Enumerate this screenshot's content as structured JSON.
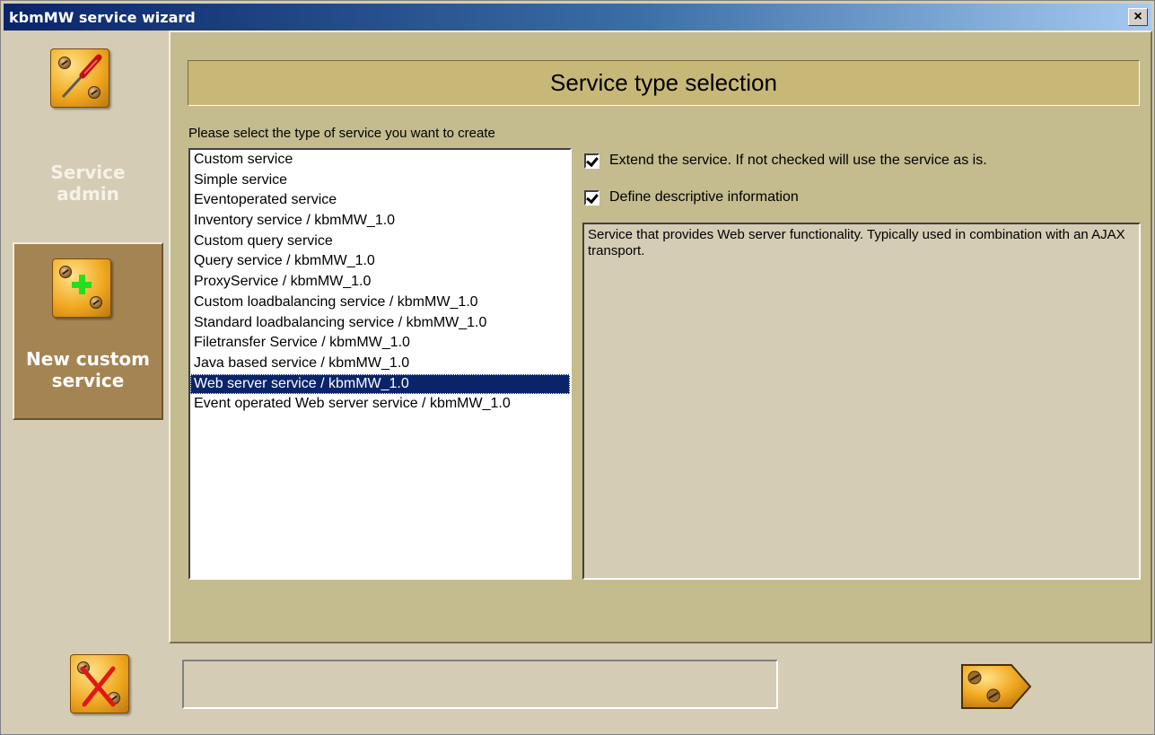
{
  "window": {
    "title": "kbmMW service wizard",
    "close_symbol": "×"
  },
  "sidebar": {
    "items": [
      {
        "label_line1": "Service",
        "label_line2": "admin",
        "icon": "screwdriver-icon"
      },
      {
        "label_line1": "New custom",
        "label_line2": "service",
        "icon": "new-plus-icon",
        "active": true
      }
    ]
  },
  "main": {
    "header_title": "Service type selection",
    "instruction": "Please select the type of service you want to create",
    "service_types": [
      "Custom service",
      "Simple service",
      "Eventoperated service",
      "Inventory service / kbmMW_1.0",
      "Custom query service",
      "Query service / kbmMW_1.0",
      "ProxyService / kbmMW_1.0",
      "Custom loadbalancing service / kbmMW_1.0",
      "Standard loadbalancing service / kbmMW_1.0",
      "Filetransfer Service / kbmMW_1.0",
      "Java based service / kbmMW_1.0",
      "Web server service / kbmMW_1.0",
      "Event operated Web server service / kbmMW_1.0"
    ],
    "selected_index": 11,
    "options": {
      "extend_label": "Extend the service. If not checked will use the service as is.",
      "extend_checked": true,
      "define_label": "Define descriptive information",
      "define_checked": true
    },
    "description": "Service that provides Web server functionality. Typically used in combination with an AJAX transport."
  },
  "footer": {
    "cancel_icon": "cancel-x-icon",
    "next_icon": "next-tag-icon",
    "status_text": ""
  },
  "colors": {
    "title_gradient_start": "#0a246a",
    "panel_bg": "#c4bc8e",
    "header_bg": "#c8b878",
    "selection": "#0a246a",
    "sidebar_active": "#a48452",
    "tile_orange": "#f0a820"
  }
}
